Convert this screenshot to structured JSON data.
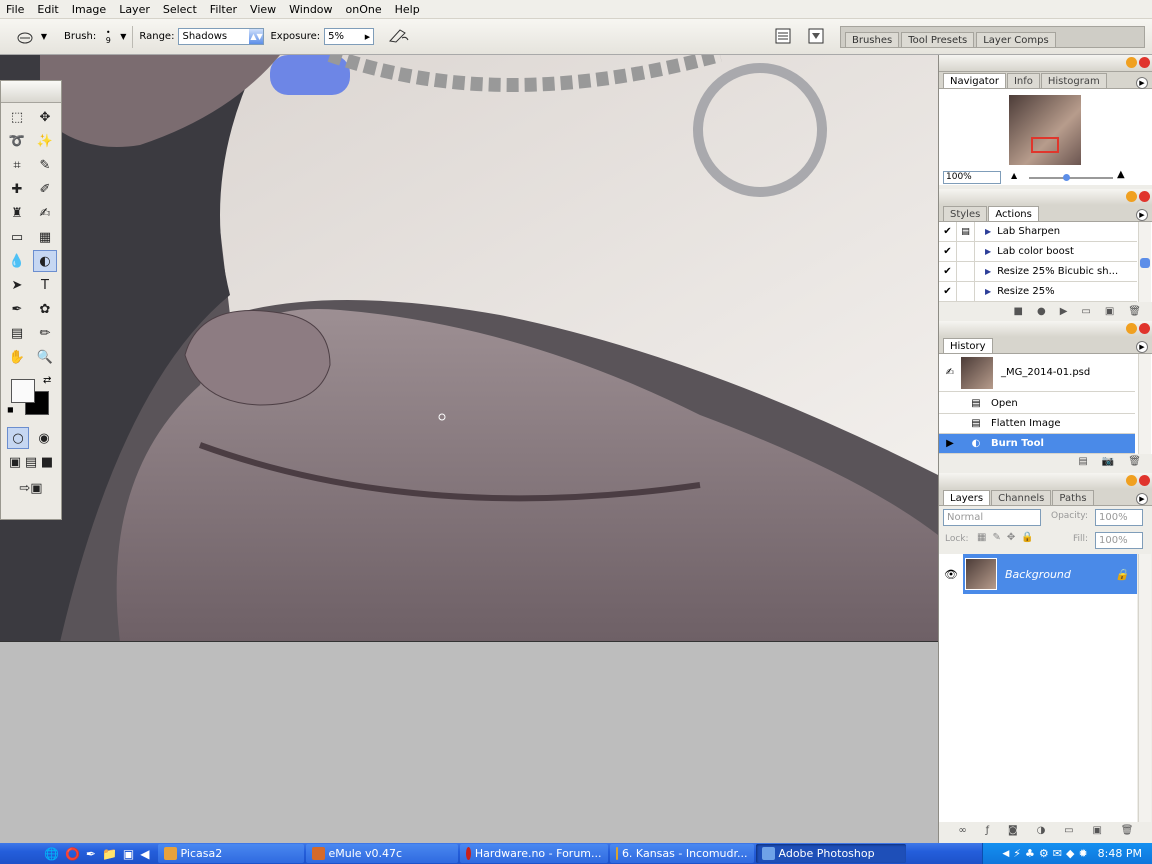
{
  "menubar": {
    "items": [
      "File",
      "Edit",
      "Image",
      "Layer",
      "Select",
      "Filter",
      "View",
      "Window",
      "onOne",
      "Help"
    ]
  },
  "options": {
    "brush_label": "Brush:",
    "brush_size": "9",
    "range_label": "Range:",
    "range_value": "Shadows",
    "exposure_label": "Exposure:",
    "exposure_value": "5%"
  },
  "palette_well": {
    "tabs": [
      "Brushes",
      "Tool Presets",
      "Layer Comps"
    ]
  },
  "navigator": {
    "tabs": [
      "Navigator",
      "Info",
      "Histogram"
    ],
    "zoom": "100%"
  },
  "actions": {
    "tabs": [
      "Styles",
      "Actions"
    ],
    "items": [
      {
        "label": "Lab Sharpen"
      },
      {
        "label": "Lab color boost"
      },
      {
        "label": "Resize 25% Bicubic sh..."
      },
      {
        "label": "Resize 25%"
      }
    ]
  },
  "history": {
    "tab": "History",
    "snapshot": "_MG_2014-01.psd",
    "states": [
      "Open",
      "Flatten Image",
      "Burn Tool"
    ]
  },
  "layers": {
    "tabs": [
      "Layers",
      "Channels",
      "Paths"
    ],
    "blend_mode": "Normal",
    "opacity_label": "Opacity:",
    "opacity_value": "100%",
    "lock_label": "Lock:",
    "fill_label": "Fill:",
    "fill_value": "100%",
    "layer_name": "Background"
  },
  "taskbar": {
    "tasks": [
      "Picasa2",
      "eMule v0.47c",
      "Hardware.no - Forum...",
      "6. Kansas - Incomudr...",
      "Adobe Photoshop"
    ],
    "clock": "8:48 PM"
  },
  "colors": {
    "accent": "#4a8ae8",
    "taskbar": "#245edb"
  }
}
